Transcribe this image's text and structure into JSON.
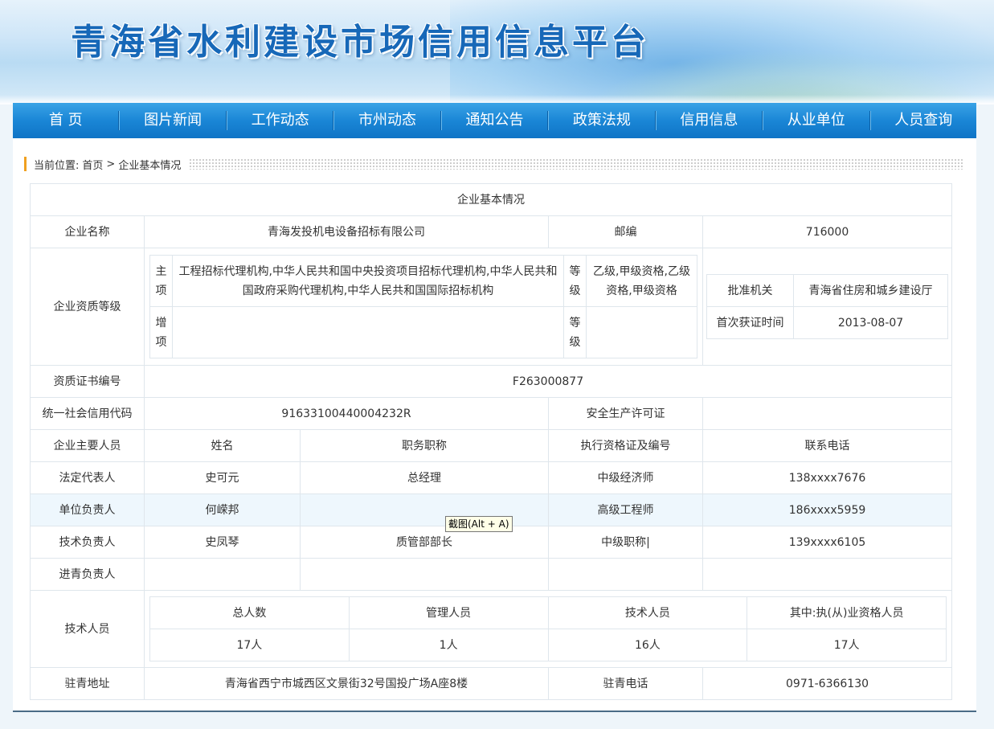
{
  "site": {
    "title": "青海省水利建设市场信用信息平台"
  },
  "nav": [
    "首 页",
    "图片新闻",
    "工作动态",
    "市州动态",
    "通知公告",
    "政策法规",
    "信用信息",
    "从业单位",
    "人员查询"
  ],
  "breadcrumb": {
    "prefix": "当前位置:",
    "home": "首页",
    "separator": ">",
    "current": "企业基本情况"
  },
  "table": {
    "title": "企业基本情况",
    "company": {
      "label": "企业名称",
      "value": "青海发投机电设备招标有限公司",
      "postcode_label": "邮编",
      "postcode": "716000"
    },
    "qualification": {
      "label": "企业资质等级",
      "main_label": "主项",
      "main_value": "工程招标代理机构,中华人民共和国中央投资项目招标代理机构,中华人民共和国政府采购代理机构,中华人民共和国国际招标机构",
      "main_level_label": "等级",
      "main_level": "乙级,甲级资格,乙级资格,甲级资格",
      "add_label": "增项",
      "add_value": "",
      "add_level_label": "等级",
      "add_level": "",
      "authority_label": "批准机关",
      "authority": "青海省住房和城乡建设厅",
      "first_date_label": "首次获证时间",
      "first_date": "2013-08-07"
    },
    "cert": {
      "label": "资质证书编号",
      "value": "F263000877"
    },
    "credit": {
      "label": "统一社会信用代码",
      "value": "91633100440004232R",
      "safety_label": "安全生产许可证",
      "safety_value": ""
    },
    "staff_header": {
      "label": "企业主要人员",
      "name": "姓名",
      "title": "职务职称",
      "cert": "执行资格证及编号",
      "phone": "联系电话"
    },
    "staff": [
      {
        "role": "法定代表人",
        "name": "史可元",
        "title": "总经理",
        "cert": "中级经济师",
        "phone": "138xxxx7676"
      },
      {
        "role": "单位负责人",
        "name": "何嵘邦",
        "title": "",
        "cert": "高级工程师",
        "phone": "186xxxx5959"
      },
      {
        "role": "技术负责人",
        "name": "史凤琴",
        "title": "质管部部长",
        "cert": "中级职称|",
        "phone": "139xxxx6105"
      },
      {
        "role": "进青负责人",
        "name": "",
        "title": "",
        "cert": "",
        "phone": ""
      }
    ],
    "tech": {
      "label": "技术人员",
      "headers": [
        "总人数",
        "管理人员",
        "技术人员",
        "其中:执(从)业资格人员"
      ],
      "values": [
        "17人",
        "1人",
        "16人",
        "17人"
      ]
    },
    "address": {
      "label": "驻青地址",
      "value": "青海省西宁市城西区文景街32号国投广场A座8楼",
      "phone_label": "驻青电话",
      "phone": "0971-6366130"
    }
  },
  "tooltip": "截图(Alt + A)"
}
